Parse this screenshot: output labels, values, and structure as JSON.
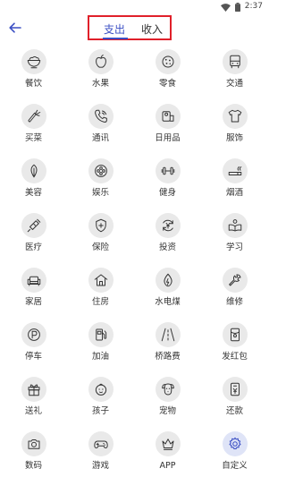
{
  "status_bar": {
    "time": "2:37"
  },
  "header": {
    "tabs": [
      {
        "label": "支出",
        "active": true
      },
      {
        "label": "收入",
        "active": false
      }
    ]
  },
  "categories": [
    {
      "label": "餐饮",
      "icon": "bowl-icon"
    },
    {
      "label": "水果",
      "icon": "apple-icon"
    },
    {
      "label": "零食",
      "icon": "cookie-icon"
    },
    {
      "label": "交通",
      "icon": "bus-icon"
    },
    {
      "label": "买菜",
      "icon": "carrot-icon"
    },
    {
      "label": "通讯",
      "icon": "phone-icon"
    },
    {
      "label": "日用品",
      "icon": "tissue-roll-icon"
    },
    {
      "label": "服饰",
      "icon": "tshirt-icon"
    },
    {
      "label": "美容",
      "icon": "leaf-icon"
    },
    {
      "label": "娱乐",
      "icon": "film-reel-icon"
    },
    {
      "label": "健身",
      "icon": "dumbbell-icon"
    },
    {
      "label": "烟酒",
      "icon": "cigarette-icon"
    },
    {
      "label": "医疗",
      "icon": "syringe-icon"
    },
    {
      "label": "保险",
      "icon": "shield-icon"
    },
    {
      "label": "投资",
      "icon": "yen-cycle-icon"
    },
    {
      "label": "学习",
      "icon": "reading-icon"
    },
    {
      "label": "家居",
      "icon": "sofa-icon"
    },
    {
      "label": "住房",
      "icon": "house-icon"
    },
    {
      "label": "水电煤",
      "icon": "flame-drop-icon"
    },
    {
      "label": "维修",
      "icon": "wrench-icon"
    },
    {
      "label": "停车",
      "icon": "parking-icon"
    },
    {
      "label": "加油",
      "icon": "fuel-pump-icon"
    },
    {
      "label": "桥路费",
      "icon": "road-icon"
    },
    {
      "label": "发红包",
      "icon": "red-envelope-icon"
    },
    {
      "label": "送礼",
      "icon": "gift-icon"
    },
    {
      "label": "孩子",
      "icon": "baby-icon"
    },
    {
      "label": "宠物",
      "icon": "dog-icon"
    },
    {
      "label": "还款",
      "icon": "repay-icon"
    },
    {
      "label": "数码",
      "icon": "camera-icon"
    },
    {
      "label": "游戏",
      "icon": "gamepad-icon"
    },
    {
      "label": "APP",
      "icon": "crown-icon"
    },
    {
      "label": "自定义",
      "icon": "gear-icon",
      "selected": true
    }
  ],
  "colors": {
    "accent": "#3b4fc4",
    "highlight_box": "#e0202a",
    "icon_circle": "#e9e9e9",
    "icon_stroke": "#333333"
  }
}
